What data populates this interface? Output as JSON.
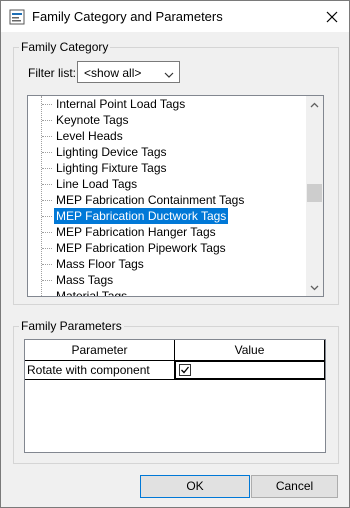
{
  "window": {
    "title": "Family Category and Parameters"
  },
  "icons": {
    "app_icon": "revit-family-icon",
    "close_icon": "close-icon",
    "dropdown_icon": "chevron-down-icon",
    "scroll_up_icon": "chevron-up-icon",
    "scroll_down_icon": "chevron-down-icon",
    "checkbox_icon": "checkmark-icon"
  },
  "category_group": {
    "caption": "Family Category",
    "filter_label": "Filter list:",
    "filter_value": "<show all>",
    "items": [
      {
        "label": "Internal Point Load Tags",
        "selected": false
      },
      {
        "label": "Keynote Tags",
        "selected": false
      },
      {
        "label": "Level Heads",
        "selected": false
      },
      {
        "label": "Lighting Device Tags",
        "selected": false
      },
      {
        "label": "Lighting Fixture Tags",
        "selected": false
      },
      {
        "label": "Line Load Tags",
        "selected": false
      },
      {
        "label": "MEP Fabrication Containment Tags",
        "selected": false
      },
      {
        "label": "MEP Fabrication Ductwork Tags",
        "selected": true
      },
      {
        "label": "MEP Fabrication Hanger Tags",
        "selected": false
      },
      {
        "label": "MEP Fabrication Pipework Tags",
        "selected": false
      },
      {
        "label": "Mass Floor Tags",
        "selected": false
      },
      {
        "label": "Mass Tags",
        "selected": false
      },
      {
        "label": "Material Tags",
        "selected": false
      }
    ]
  },
  "parameters_group": {
    "caption": "Family Parameters",
    "columns": [
      "Parameter",
      "Value"
    ],
    "rows": [
      {
        "parameter": "Rotate with component",
        "checked": true
      }
    ]
  },
  "buttons": {
    "ok": "OK",
    "cancel": "Cancel"
  },
  "colors": {
    "selection": "#0078d7",
    "selection_text": "#ffffff",
    "dialog_bg": "#f0f0f0"
  }
}
